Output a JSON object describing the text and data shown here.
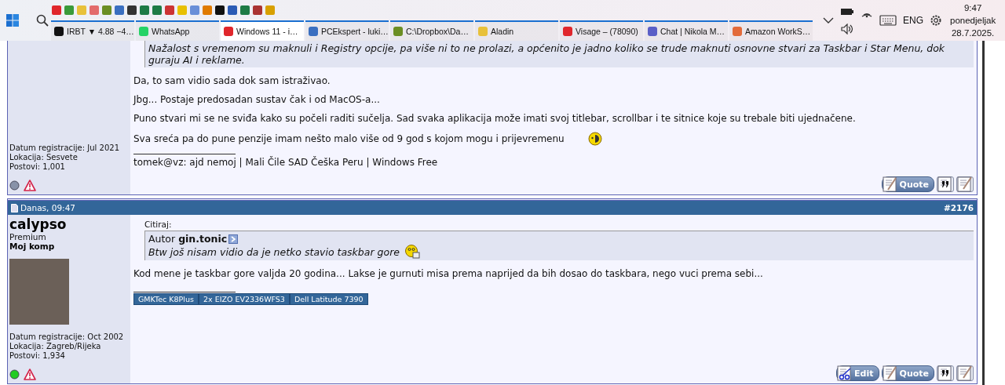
{
  "taskbar": {
    "windows": [
      {
        "label": "IRBT ▼ 4.88 −4…",
        "selected": false
      },
      {
        "label": "WhatsApp",
        "selected": false
      },
      {
        "label": "Windows 11 - i…",
        "selected": true
      },
      {
        "label": "PCEkspert - luki…",
        "selected": false
      },
      {
        "label": "C:\\Dropbox\\Da…",
        "selected": false
      },
      {
        "label": "Aladin",
        "selected": false
      },
      {
        "label": "Visage – (78090)",
        "selected": false
      },
      {
        "label": "Chat | Nikola M…",
        "selected": false
      },
      {
        "label": "Amazon WorkS…",
        "selected": false
      }
    ],
    "language": "ENG",
    "time": "9:47",
    "day": "ponedjeljak",
    "date": "28.7.2025."
  },
  "posts": [
    {
      "user": {
        "info": [
          "Datum registracije: Jul 2021",
          "Lokacija: Sesvete",
          "Postovi: 1,001"
        ],
        "online": false
      },
      "quote": {
        "text": "Nažalost s vremenom su maknuli i Registry opcije, pa više ni to ne prolazi, a općenito je jadno koliko se trude maknuti osnovne stvari za Taskbar i Star Menu, dok guraju AI i reklame."
      },
      "paragraphs": [
        "Da, to sam vidio sada dok sam istraživao.",
        "Jbg... Postaje predosadan sustav čak i od MacOS-a...",
        "Puno stvari mi se ne sviđa kako su počeli raditi sučelja. Sad svaka aplikacija može imati svoj titlebar, scrollbar i te sitnice koje su trebale biti ujednačene.",
        "Sva sreća pa do pune penzije imam nešto malo više od 9 god s kojom mogu i prijevremenu"
      ],
      "signature": {
        "text": "tomek@vz: ajd nemoj | Mali Čile SAD Češka Peru | Windows Free"
      },
      "buttons": [
        {
          "kind": "quote",
          "label": "Quote"
        },
        {
          "kind": "multiquote"
        },
        {
          "kind": "reply"
        }
      ]
    },
    {
      "header": {
        "date": "Danas, 09:47",
        "number": "#2176"
      },
      "user": {
        "name": "calypso",
        "title": "Premium",
        "extra": "Moj komp",
        "info": [
          "Datum registracije: Oct 2002",
          "Lokacija: Zagreb/Rijeka",
          "Postovi: 1,934"
        ],
        "online": true
      },
      "quote": {
        "label": "Citiraj:",
        "author": "Autor **gin.tonic**",
        "text": "Btw još nisam vidio da je netko stavio taskbar gore"
      },
      "paragraphs": [
        "Kod mene je taskbar gore valjda 20 godina... Lakse je gurnuti misa prema naprijed da bih dosao do taskbara, nego vuci prema sebi..."
      ],
      "signature": {
        "badges": [
          "GMKTec K8Plus",
          "2x EIZO EV2336WFS3",
          "Dell Latitude 7390"
        ]
      },
      "buttons": [
        {
          "kind": "edit",
          "label": "Edit"
        },
        {
          "kind": "quote",
          "label": "Quote"
        },
        {
          "kind": "multiquote"
        },
        {
          "kind": "reply"
        }
      ]
    }
  ]
}
